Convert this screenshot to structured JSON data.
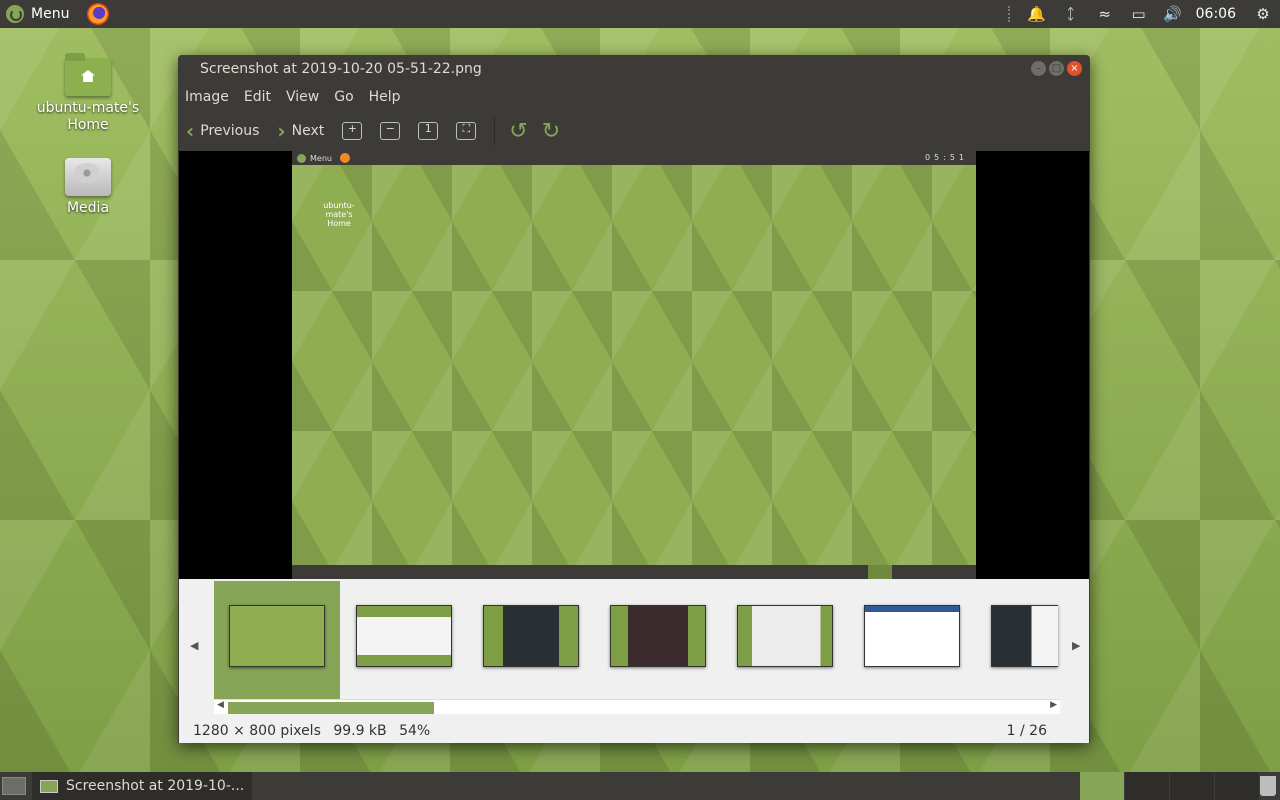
{
  "top_panel": {
    "menu_label": "Menu",
    "tray_icons": [
      "bell-icon",
      "bluetooth-icon",
      "wifi-icon",
      "battery-icon",
      "volume-icon"
    ],
    "clock": "06:06"
  },
  "desktop": {
    "icons": [
      {
        "label": "ubuntu-mate's Home",
        "icon": "home-folder-icon"
      },
      {
        "label": "Media",
        "icon": "drive-icon"
      }
    ]
  },
  "window": {
    "title": "Screenshot at 2019-10-20 05-51-22.png",
    "menu": [
      "Image",
      "Edit",
      "View",
      "Go",
      "Help"
    ],
    "toolbar": {
      "previous_label": "Previous",
      "next_label": "Next"
    },
    "image": {
      "inner_menu_label": "Menu",
      "inner_clock": "05:51",
      "inner_icon_label": "ubuntu-mate's Home"
    },
    "thumbnails_count_visible": 7,
    "status": {
      "dimensions": "1280 × 800 pixels",
      "size": "99.9 kB",
      "zoom": "54%",
      "position": "1 / 26"
    }
  },
  "bottom_panel": {
    "task_label": "Screenshot at 2019-10-..."
  },
  "colors": {
    "accent": "#87a556",
    "panel": "#3c3b37",
    "close": "#e0522b"
  }
}
